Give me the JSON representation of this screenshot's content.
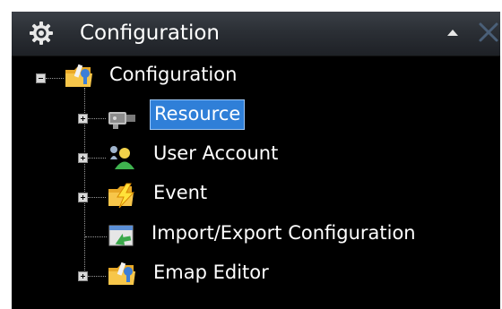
{
  "panel": {
    "title": "Configuration",
    "title_icon": "gear-icon",
    "collapse_icon": "chevron-up-icon",
    "close_icon": "close-icon"
  },
  "tree": {
    "root": {
      "label": "Configuration",
      "icon": "folder-wrench-icon",
      "expander": "minus"
    },
    "items": [
      {
        "label": "Resource",
        "icon": "camera-icon",
        "expander": "plus",
        "selected": true
      },
      {
        "label": "User Account",
        "icon": "users-icon",
        "expander": "plus",
        "selected": false
      },
      {
        "label": "Event",
        "icon": "lightning-folder-icon",
        "expander": "plus",
        "selected": false
      },
      {
        "label": "Import/Export Configuration",
        "icon": "import-export-icon",
        "expander": "none",
        "selected": false
      },
      {
        "label": "Emap Editor",
        "icon": "folder-wrench-icon",
        "expander": "plus",
        "selected": false
      }
    ]
  },
  "colors": {
    "background": "#000000",
    "titlebar": "#2b2f35",
    "selection": "#2f7fd8",
    "text": "#ffffff"
  }
}
